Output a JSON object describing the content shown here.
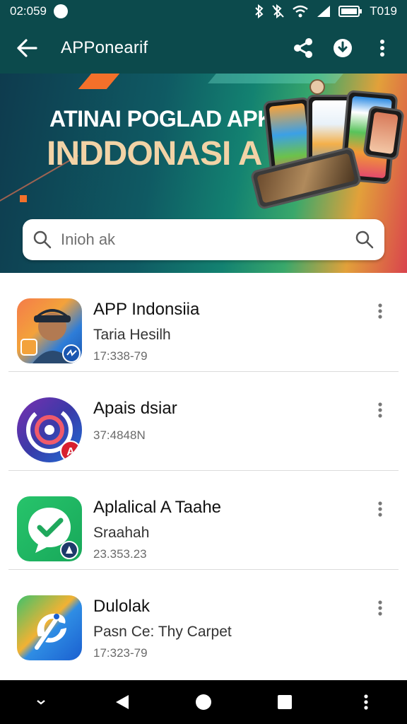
{
  "status_bar": {
    "time": "02:059",
    "right_text": "T019"
  },
  "app_bar": {
    "title": "APPonearif"
  },
  "banner": {
    "line1": "ATINAI POGLAD APK",
    "line2": "INDDONASI A"
  },
  "search": {
    "placeholder": "Inioh ak"
  },
  "apps": [
    {
      "title": "APP Indonsiia",
      "subtitle": "Taria Hesilh",
      "date": "17:338-79",
      "icon": "person-photo-icon"
    },
    {
      "title": "Apais dsiar",
      "subtitle": "",
      "date": "37:4848N",
      "icon": "circular-swirl-icon"
    },
    {
      "title": "Aplalical A Taahe",
      "subtitle": "Sraahah",
      "date": "23.353.23",
      "icon": "chat-check-icon"
    },
    {
      "title": "Dulolak",
      "subtitle": "Pasn Ce: Thy Carpet",
      "date": "17:323-79",
      "icon": "bird-swirl-icon"
    }
  ],
  "colors": {
    "app_bar": "#0c4a4c",
    "nav_bar": "#000000",
    "accent_orange": "#f3702a"
  }
}
